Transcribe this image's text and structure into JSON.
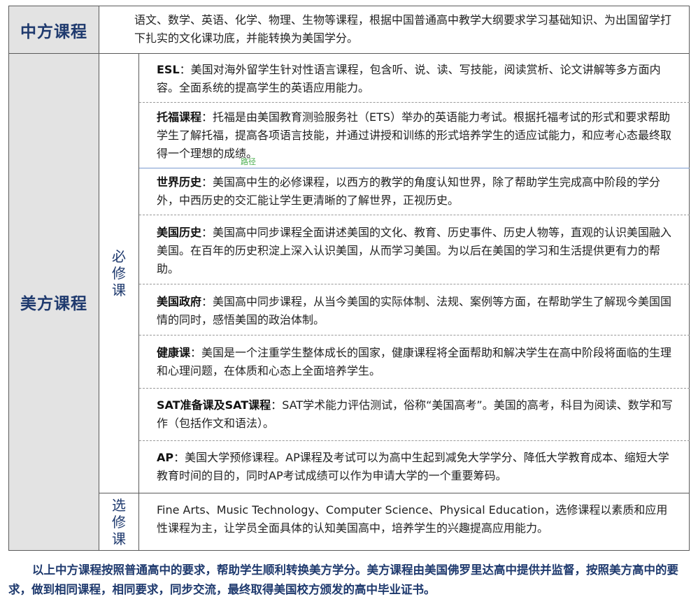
{
  "chinese_course": {
    "header": "中方课程",
    "description": "语文、数学、英语、化学、物理、生物等课程，根据中国普通高中教学大纲要求学习基础知识、为出国留学打下扎实的文化课功底，并能转换为美国学分。"
  },
  "american_course": {
    "header": "美方课程",
    "required": {
      "label_chars": [
        "必",
        "修",
        "课"
      ],
      "items": [
        {
          "title": "ESL",
          "sep": "：",
          "text": "美国对海外留学生针对性语言课程，包含听、说、读、写技能，阅读赏析、论文讲解等多方面内容。全面系统的提高学生的英语应用能力。"
        },
        {
          "title": "托福课程",
          "sep": "：",
          "text": "托福是由美国教育测验服务社（ETS）举办的英语能力考试。根据托福考试的形式和要求帮助学生了解托福，提高各项语言技能，并通过讲授和训练的形式培养学生的适应试能力，和应考心态最终取得一个理想的成绩。"
        },
        {
          "title": "世界历史",
          "sep": "：",
          "text": "美国高中生的必修课程，以西方的教学的角度认知世界，除了帮助学生完成高中阶段的学分外，中西历史的交汇能让学生更清晰的了解世界，正视历史。"
        },
        {
          "title": "美国历史",
          "sep": "：",
          "text": "美国高中同步课程全面讲述美国的文化、教育、历史事件、历史人物等，直观的认识美国融入美国。在百年的历史积淀上深入认识美国，从而学习美国。为以后在美国的学习和生活提供更有力的帮助。"
        },
        {
          "title": "美国政府",
          "sep": "：",
          "text": "美国高中同步课程，从当今美国的实际体制、法规、案例等方面，在帮助学生了解现今美国国情的同时，感悟美国的政治体制。"
        },
        {
          "title": "健康课",
          "sep": "：",
          "text": "美国是一个注重学生整体成长的国家，健康课程将全面帮助和解决学生在高中阶段将面临的生理和心理问题，在体质和心态上全面培养学生。"
        },
        {
          "title": "SAT准备课及SAT课程",
          "sep": "：",
          "text": "SAT学术能力评估测试，俗称“美国高考”。美国的高考，科目为阅读、数学和写作（包括作文和语法）。"
        },
        {
          "title": "AP",
          "sep": "：",
          "text": "美国大学预修课程。AP课程及考试可以为高中生起到减免大学学分、降低大学教育成本、缩短大学教育时间的目的，同时AP考试成绩可以作为申请大学的一个重要筹码。"
        }
      ]
    },
    "elective": {
      "label_chars": [
        "选",
        "修",
        "课"
      ],
      "text": "Fine Arts、Music Technology、Computer Science、Physical Education，选修课程以素质和应用性课程为主，让学员全面具体的认知美国高中，培养学生的兴趣提高应用能力。"
    }
  },
  "stamp_text": "路径",
  "footer": "以上中方课程按照普通高中的要求，帮助学生顺利转换美方学分。美方课程由美国佛罗里达高中提供并监督，按照美方高中的要求，做到相同课程，相同要求，同步交流，最终取得美国校方颁发的高中毕业证书。"
}
